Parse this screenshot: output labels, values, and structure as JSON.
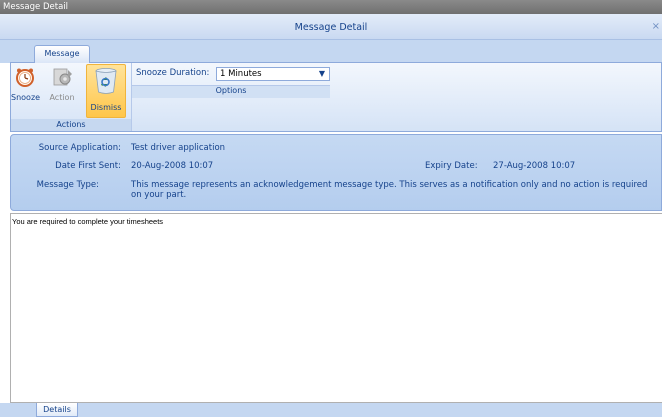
{
  "window": {
    "outer_title": "Message Detail",
    "dialog_title": "Message Detail",
    "close_glyph": "×"
  },
  "ribbon": {
    "tab_label": "Message",
    "actions_group": {
      "label": "Actions",
      "buttons": [
        {
          "label": "Snooze",
          "icon": "alarm-clock-icon",
          "enabled": true
        },
        {
          "label": "Action",
          "icon": "gears-icon",
          "enabled": false
        },
        {
          "label": "Dismiss",
          "icon": "recycle-bin-icon",
          "enabled": true,
          "highlighted": true
        }
      ]
    },
    "options_group": {
      "label": "Options",
      "snooze_duration_label": "Snooze Duration:",
      "snooze_duration_value": "1 Minutes"
    }
  },
  "details": {
    "source_application_label": "Source Application:",
    "source_application_value": "Test driver application",
    "date_first_sent_label": "Date First Sent:",
    "date_first_sent_value": "20-Aug-2008 10:07",
    "expiry_date_label": "Expiry Date:",
    "expiry_date_value": "27-Aug-2008 10:07",
    "message_type_label": "Message Type:",
    "message_type_value": "This message represents an acknowledgement message type. This serves as a notification only and no action is required on your part."
  },
  "body": {
    "text": "You are required to complete your timesheets"
  },
  "bottom_tab": {
    "label": "Details"
  },
  "colors": {
    "ribbon_blue": "#c4d7f1",
    "text_blue": "#15428b",
    "dismiss_orange": "#ffc64a"
  }
}
